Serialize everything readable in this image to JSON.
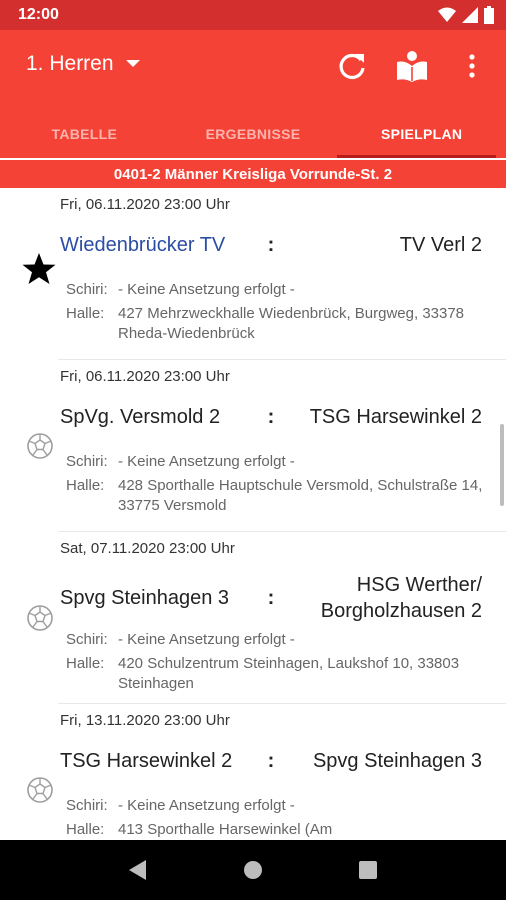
{
  "status_bar": {
    "time": "12:00"
  },
  "app_bar": {
    "team": "1. Herren",
    "actions": [
      "refresh-icon",
      "book-reader-icon",
      "more-vert-icon"
    ]
  },
  "tabs": [
    {
      "label": "TABELLE"
    },
    {
      "label": "ERGEBNISSE"
    },
    {
      "label": "SPIELPLAN",
      "active": true
    }
  ],
  "league": "0401-2 Männer Kreisliga Vorrunde-St. 2",
  "colors": {
    "primary": "#f44336",
    "status": "#d32f2f",
    "indicator": "#b71c1c",
    "favorite_text": "#2b4ea3"
  },
  "matches": [
    {
      "date": "Fri, 06.11.2020 23:00 Uhr",
      "home": "Wiedenbrücker TV",
      "separator": ":",
      "away": "TV Verl 2",
      "icon": "star-icon",
      "referee_label": "Schiri:",
      "referee": "- Keine Ansetzung erfolgt -",
      "hall_label": "Halle:",
      "hall": "427 Mehrzweckhalle Wiedenbrück, Burgweg, 33378 Rheda-Wiedenbrück"
    },
    {
      "date": "Fri, 06.11.2020 23:00 Uhr",
      "home": "SpVg. Versmold 2",
      "separator": ":",
      "away": "TSG Harsewinkel 2",
      "icon": "handball-icon",
      "referee_label": "Schiri:",
      "referee": "- Keine Ansetzung erfolgt -",
      "hall_label": "Halle:",
      "hall": "428 Sporthalle Hauptschule Versmold, Schulstraße 14, 33775 Versmold"
    },
    {
      "date": "Sat, 07.11.2020 23:00 Uhr",
      "home": "Spvg Steinhagen 3",
      "separator": ":",
      "away": "HSG Werther/ Borgholzhausen 2",
      "icon": "handball-icon",
      "referee_label": "Schiri:",
      "referee": "- Keine Ansetzung erfolgt -",
      "hall_label": "Halle:",
      "hall": "420 Schulzentrum Steinhagen, Laukshof 10, 33803 Steinhagen"
    },
    {
      "date": "Fri, 13.11.2020 23:00 Uhr",
      "home": "TSG Harsewinkel 2",
      "separator": ":",
      "away": "Spvg Steinhagen 3",
      "icon": "handball-icon",
      "referee_label": "Schiri:",
      "referee": "- Keine Ansetzung erfolgt -",
      "hall_label": "Halle:",
      "hall": "413 Sporthalle Harsewinkel (Am"
    }
  ],
  "nav": [
    "back-icon",
    "home-icon",
    "recents-icon"
  ]
}
